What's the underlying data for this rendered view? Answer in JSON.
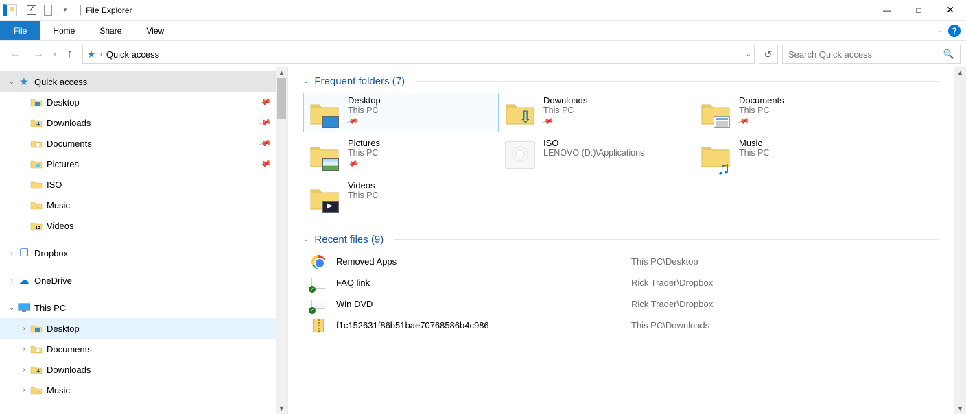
{
  "title": "File Explorer",
  "ribbon": {
    "file_label": "File",
    "tabs": [
      "Home",
      "Share",
      "View"
    ]
  },
  "address": {
    "location": "Quick access"
  },
  "search": {
    "placeholder": "Search Quick access"
  },
  "tree": {
    "quick_access": {
      "label": "Quick access",
      "items": [
        {
          "label": "Desktop",
          "pinned": true,
          "icon": "desktop"
        },
        {
          "label": "Downloads",
          "pinned": true,
          "icon": "downloads"
        },
        {
          "label": "Documents",
          "pinned": true,
          "icon": "documents"
        },
        {
          "label": "Pictures",
          "pinned": true,
          "icon": "pictures"
        },
        {
          "label": "ISO",
          "pinned": false,
          "icon": "folder"
        },
        {
          "label": "Music",
          "pinned": false,
          "icon": "music"
        },
        {
          "label": "Videos",
          "pinned": false,
          "icon": "videos"
        }
      ]
    },
    "dropbox": {
      "label": "Dropbox"
    },
    "onedrive": {
      "label": "OneDrive"
    },
    "this_pc": {
      "label": "This PC",
      "items": [
        {
          "label": "Desktop",
          "icon": "desktop"
        },
        {
          "label": "Documents",
          "icon": "documents"
        },
        {
          "label": "Downloads",
          "icon": "downloads"
        },
        {
          "label": "Music",
          "icon": "music"
        }
      ]
    }
  },
  "sections": {
    "frequent": {
      "title": "Frequent folders (7)",
      "items": [
        {
          "name": "Desktop",
          "loc": "This PC",
          "pinned": true,
          "icon": "desktop",
          "selected": true
        },
        {
          "name": "Downloads",
          "loc": "This PC",
          "pinned": true,
          "icon": "downloads"
        },
        {
          "name": "Documents",
          "loc": "This PC",
          "pinned": true,
          "icon": "documents"
        },
        {
          "name": "Pictures",
          "loc": "This PC",
          "pinned": true,
          "icon": "pictures"
        },
        {
          "name": "ISO",
          "loc": "LENOVO (D:)\\Applications",
          "pinned": false,
          "icon": "iso"
        },
        {
          "name": "Music",
          "loc": "This PC",
          "pinned": false,
          "icon": "music"
        },
        {
          "name": "Videos",
          "loc": "This PC",
          "pinned": false,
          "icon": "videos"
        }
      ]
    },
    "recent": {
      "title": "Recent files (9)",
      "items": [
        {
          "name": "Removed Apps",
          "path": "This PC\\Desktop",
          "icon": "chrome"
        },
        {
          "name": "FAQ link",
          "path": "Rick Trader\\Dropbox",
          "icon": "link"
        },
        {
          "name": "Win DVD",
          "path": "Rick Trader\\Dropbox",
          "icon": "cd"
        },
        {
          "name": "f1c152631f86b51bae70768586b4c986",
          "path": "This PC\\Downloads",
          "icon": "zip"
        }
      ]
    }
  }
}
